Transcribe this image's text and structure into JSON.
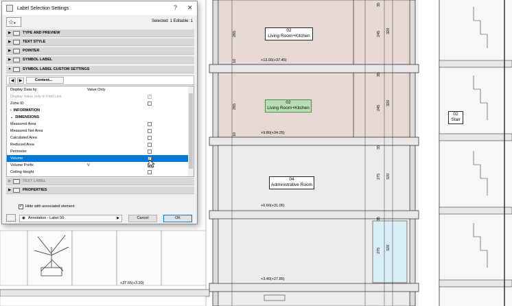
{
  "dialog": {
    "title": "Label Selection Settings",
    "help": "?",
    "close": "✕",
    "selection_info": "Selected: 1 Editable: 1",
    "sections": [
      {
        "label": "TYPE AND PREVIEW"
      },
      {
        "label": "TEXT STYLE"
      },
      {
        "label": "POINTER"
      },
      {
        "label": "SYMBOL LABEL"
      },
      {
        "label": "SYMBOL LABEL CUSTOM SETTINGS"
      }
    ],
    "content_button": "Content...",
    "list": {
      "rows": [
        {
          "label": "Display Data by",
          "value": "Value Only"
        },
        {
          "label": "Display Value only in First Line"
        },
        {
          "label": "Zone ID"
        },
        {
          "label": "INFORMATION"
        },
        {
          "label": "DIMENSIONS"
        },
        {
          "label": "Measured Area"
        },
        {
          "label": "Measured Net Area"
        },
        {
          "label": "Calculated Area"
        },
        {
          "label": "Reduced Area"
        },
        {
          "label": "Perimeter"
        },
        {
          "label": "Volume"
        },
        {
          "label": "Volume Prefix",
          "value": "V"
        },
        {
          "label": "Ceiling Height"
        }
      ]
    },
    "lower_sections": [
      {
        "label": "TEXT LABEL"
      },
      {
        "label": "PROPERTIES"
      }
    ],
    "hide_label": "Hide with associated element",
    "favorite": "Annotation - Label 50",
    "cancel": "Cancel",
    "ok": "OK"
  },
  "drawing": {
    "rooms": [
      {
        "num": "02",
        "name": "Living Room+Kitchen"
      },
      {
        "num": "02",
        "name": "Living Room+Kitchen"
      },
      {
        "num": "04",
        "name": "Administrative Room"
      },
      {
        "num": "02",
        "name": "Stair"
      }
    ],
    "elevations": [
      "+13.00(+37.45)",
      "+9.80(+34.25)",
      "+6.60(+31.05)",
      "+3.40(+27.85)",
      "+27.65(+3.20)"
    ],
    "dims": [
      "265",
      "10",
      "245",
      "320",
      "35",
      "275",
      "10",
      "265",
      "10",
      "245",
      "320",
      "35",
      "275",
      "10",
      "320",
      "35",
      "275",
      "10",
      "320",
      "35"
    ]
  }
}
